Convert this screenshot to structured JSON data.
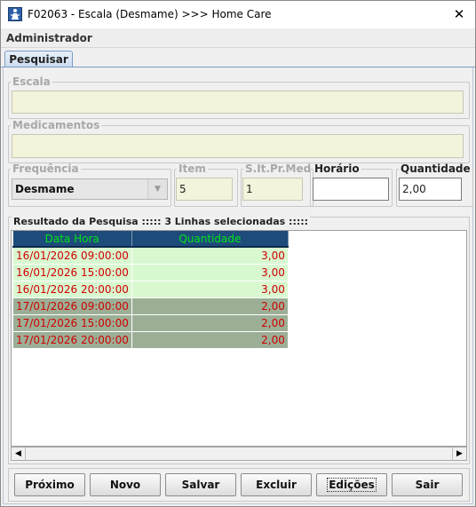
{
  "window": {
    "title": "F02063 - Escala (Desmame) >>> Home Care",
    "close_glyph": "✕",
    "user": "Administrador"
  },
  "tabs": [
    {
      "label": "Pesquisar",
      "active": true
    }
  ],
  "form": {
    "escala": {
      "label": "Escala",
      "value": ""
    },
    "medicamentos": {
      "label": "Medicamentos",
      "value": ""
    },
    "frequencia": {
      "label": "Frequência",
      "value": "Desmame"
    },
    "item": {
      "label": "Item",
      "value": "5"
    },
    "slt": {
      "label": "S.It.Pr.Med",
      "value": "1"
    },
    "horario": {
      "label": "Horário",
      "value": ""
    },
    "quantidade": {
      "label": "Quantidade",
      "value": "2,00"
    }
  },
  "results": {
    "legend": "Resultado da Pesquisa ::::: 3 Linhas selecionadas :::::",
    "columns": [
      "Data Hora",
      "Quantidade"
    ],
    "rows": [
      {
        "data_hora": "16/01/2026 09:00:00",
        "quantidade": "3,00",
        "style": "light"
      },
      {
        "data_hora": "16/01/2026 15:00:00",
        "quantidade": "3,00",
        "style": "light"
      },
      {
        "data_hora": "16/01/2026 20:00:00",
        "quantidade": "3,00",
        "style": "light"
      },
      {
        "data_hora": "17/01/2026 09:00:00",
        "quantidade": "2,00",
        "style": "dark"
      },
      {
        "data_hora": "17/01/2026 15:00:00",
        "quantidade": "2,00",
        "style": "dark"
      },
      {
        "data_hora": "17/01/2026 20:00:00",
        "quantidade": "2,00",
        "style": "dark"
      }
    ]
  },
  "buttons": {
    "proximo": "Próximo",
    "novo": "Novo",
    "salvar": "Salvar",
    "excluir": "Excluir",
    "edicoes": "Edições",
    "sair": "Sair"
  },
  "colors": {
    "header_bg": "#1e4c7a",
    "header_text": "#00e41a",
    "row_text": "#d00000",
    "row_light": "#d8f8d0",
    "row_dark": "#9caf96",
    "readonly_field": "#f4f4dc"
  }
}
